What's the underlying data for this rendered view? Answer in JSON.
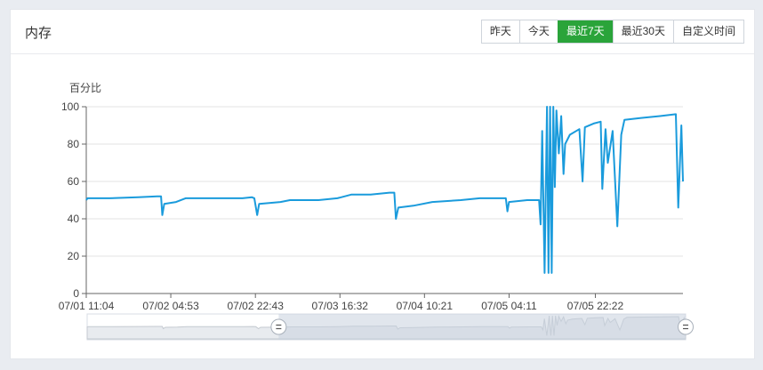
{
  "panel": {
    "title": "内存"
  },
  "time_range": {
    "options": [
      {
        "label": "昨天",
        "active": false
      },
      {
        "label": "今天",
        "active": false
      },
      {
        "label": "最近7天",
        "active": true
      },
      {
        "label": "最近30天",
        "active": false
      },
      {
        "label": "自定义时间",
        "active": false
      }
    ]
  },
  "colors": {
    "line": "#1a9bdc",
    "accent": "#2aa43a",
    "grid": "#e3e3e3"
  },
  "chart_data": {
    "type": "line",
    "ylabel": "百分比",
    "ylim": [
      0,
      100
    ],
    "yticks": [
      0,
      20,
      40,
      60,
      80,
      100
    ],
    "xlim": [
      "07/01 11:04",
      "07/06 16:50"
    ],
    "xticks": [
      "07/01 11:04",
      "07/02 04:53",
      "07/02 22:43",
      "07/03 16:32",
      "07/04 10:21",
      "07/05 04:11",
      "07/05 22:22"
    ],
    "grid": true,
    "series": [
      {
        "points": [
          [
            "07/01 11:04",
            50
          ],
          [
            "07/01 11:20",
            51
          ],
          [
            "07/01 16:00",
            51
          ],
          [
            "07/01 22:00",
            51.5
          ],
          [
            "07/02 02:00",
            52
          ],
          [
            "07/02 02:50",
            52
          ],
          [
            "07/02 03:05",
            42
          ],
          [
            "07/02 03:30",
            48
          ],
          [
            "07/02 06:00",
            49
          ],
          [
            "07/02 08:00",
            51
          ],
          [
            "07/02 14:00",
            51
          ],
          [
            "07/02 20:00",
            51
          ],
          [
            "07/02 22:00",
            51.5
          ],
          [
            "07/02 22:30",
            51
          ],
          [
            "07/02 23:05",
            42
          ],
          [
            "07/02 23:30",
            48
          ],
          [
            "07/03 04:00",
            49
          ],
          [
            "07/03 06:00",
            50
          ],
          [
            "07/03 12:00",
            50
          ],
          [
            "07/03 16:00",
            51
          ],
          [
            "07/03 19:00",
            53
          ],
          [
            "07/03 23:00",
            53
          ],
          [
            "07/04 03:00",
            54
          ],
          [
            "07/04 04:00",
            54
          ],
          [
            "07/04 04:20",
            40
          ],
          [
            "07/04 04:50",
            46
          ],
          [
            "07/04 08:00",
            47
          ],
          [
            "07/04 12:00",
            49
          ],
          [
            "07/04 18:00",
            50
          ],
          [
            "07/04 22:00",
            51
          ],
          [
            "07/05 03:30",
            51
          ],
          [
            "07/05 03:50",
            44
          ],
          [
            "07/05 04:10",
            49
          ],
          [
            "07/05 08:00",
            50
          ],
          [
            "07/05 10:30",
            50
          ],
          [
            "07/05 10:50",
            37
          ],
          [
            "07/05 11:10",
            87
          ],
          [
            "07/05 11:40",
            11
          ],
          [
            "07/05 12:10",
            100
          ],
          [
            "07/05 12:30",
            11
          ],
          [
            "07/05 12:50",
            100
          ],
          [
            "07/05 13:10",
            11
          ],
          [
            "07/05 13:30",
            100
          ],
          [
            "07/05 13:50",
            57
          ],
          [
            "07/05 14:10",
            98
          ],
          [
            "07/05 14:40",
            75
          ],
          [
            "07/05 15:10",
            95
          ],
          [
            "07/05 15:40",
            64
          ],
          [
            "07/05 16:00",
            80
          ],
          [
            "07/05 17:00",
            85
          ],
          [
            "07/05 19:00",
            88
          ],
          [
            "07/05 19:40",
            60
          ],
          [
            "07/05 20:10",
            89
          ],
          [
            "07/05 22:00",
            91
          ],
          [
            "07/05 23:30",
            92
          ],
          [
            "07/05 23:50",
            56
          ],
          [
            "07/06 00:30",
            88
          ],
          [
            "07/06 01:00",
            70
          ],
          [
            "07/06 02:00",
            87
          ],
          [
            "07/06 03:00",
            36
          ],
          [
            "07/06 03:50",
            85
          ],
          [
            "07/06 04:30",
            93
          ],
          [
            "07/06 08:00",
            94
          ],
          [
            "07/06 12:00",
            95
          ],
          [
            "07/06 15:20",
            96
          ],
          [
            "07/06 15:50",
            46
          ],
          [
            "07/06 16:30",
            90
          ],
          [
            "07/06 16:50",
            60
          ]
        ]
      }
    ],
    "zoom": {
      "start": 0.32,
      "end": 1.0
    }
  }
}
